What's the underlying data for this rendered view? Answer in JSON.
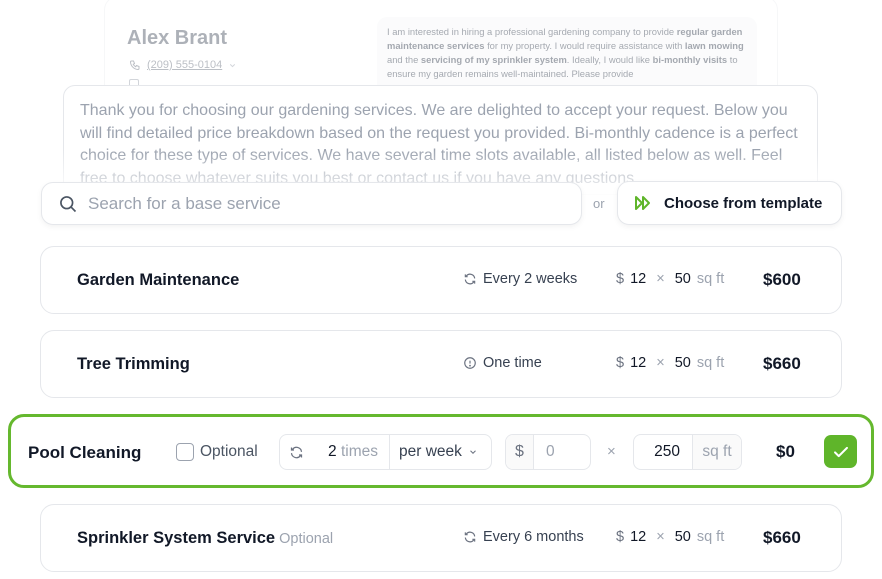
{
  "customer": {
    "name": "Alex Brant",
    "phone": "(209) 555-0104",
    "request": {
      "p1": "I am interested in hiring a professional gardening company to provide ",
      "b1": "regular garden maintenance services",
      "p2": " for my property. I would require assistance with ",
      "b2": "lawn mowing",
      "p3": " and the ",
      "b3": "servicing of my sprinkler system",
      "p4": ". Ideally, I would like ",
      "b4": "bi-monthly visits",
      "p5": " to ensure my garden remains well-maintained. Please provide"
    }
  },
  "response": {
    "text": "Thank you for choosing our gardening services. We are delighted to accept your request. Below you will find detailed price breakdown based on the request you provided. Bi-monthly cadence is a perfect choice for these type of services. We have several time slots available, all listed below as well. Feel free to choose whatever suits you best or contact us if you have any questions."
  },
  "search": {
    "placeholder": "Search for a base service",
    "or_label": "or",
    "template_button": "Choose from template"
  },
  "services": [
    {
      "name": "Garden Maintenance",
      "optional": "",
      "frequency": "Every 2 weeks",
      "frequency_icon": "repeat-icon",
      "currency": "$",
      "rate": "12",
      "times": "×",
      "quantity": "50",
      "unit": "sq ft",
      "total": "$600"
    },
    {
      "name": "Tree Trimming",
      "optional": "",
      "frequency": "One time",
      "frequency_icon": "info-icon",
      "currency": "$",
      "rate": "12",
      "times": "×",
      "quantity": "50",
      "unit": "sq ft",
      "total": "$660"
    },
    {
      "name": "Sprinkler System Service",
      "optional": "Optional",
      "frequency": "Every 6 months",
      "frequency_icon": "repeat-icon",
      "currency": "$",
      "rate": "12",
      "times": "×",
      "quantity": "50",
      "unit": "sq ft",
      "total": "$660"
    }
  ],
  "editing": {
    "name": "Pool Cleaning",
    "optional_label": "Optional",
    "optional_checked": false,
    "count": "2",
    "count_unit": "times",
    "period": "per week",
    "currency": "$",
    "rate_placeholder": "0",
    "times": "×",
    "quantity": "250",
    "unit": "sq ft",
    "total": "$0"
  },
  "colors": {
    "accent": "#65b82e",
    "confirm": "#5fb52a"
  }
}
